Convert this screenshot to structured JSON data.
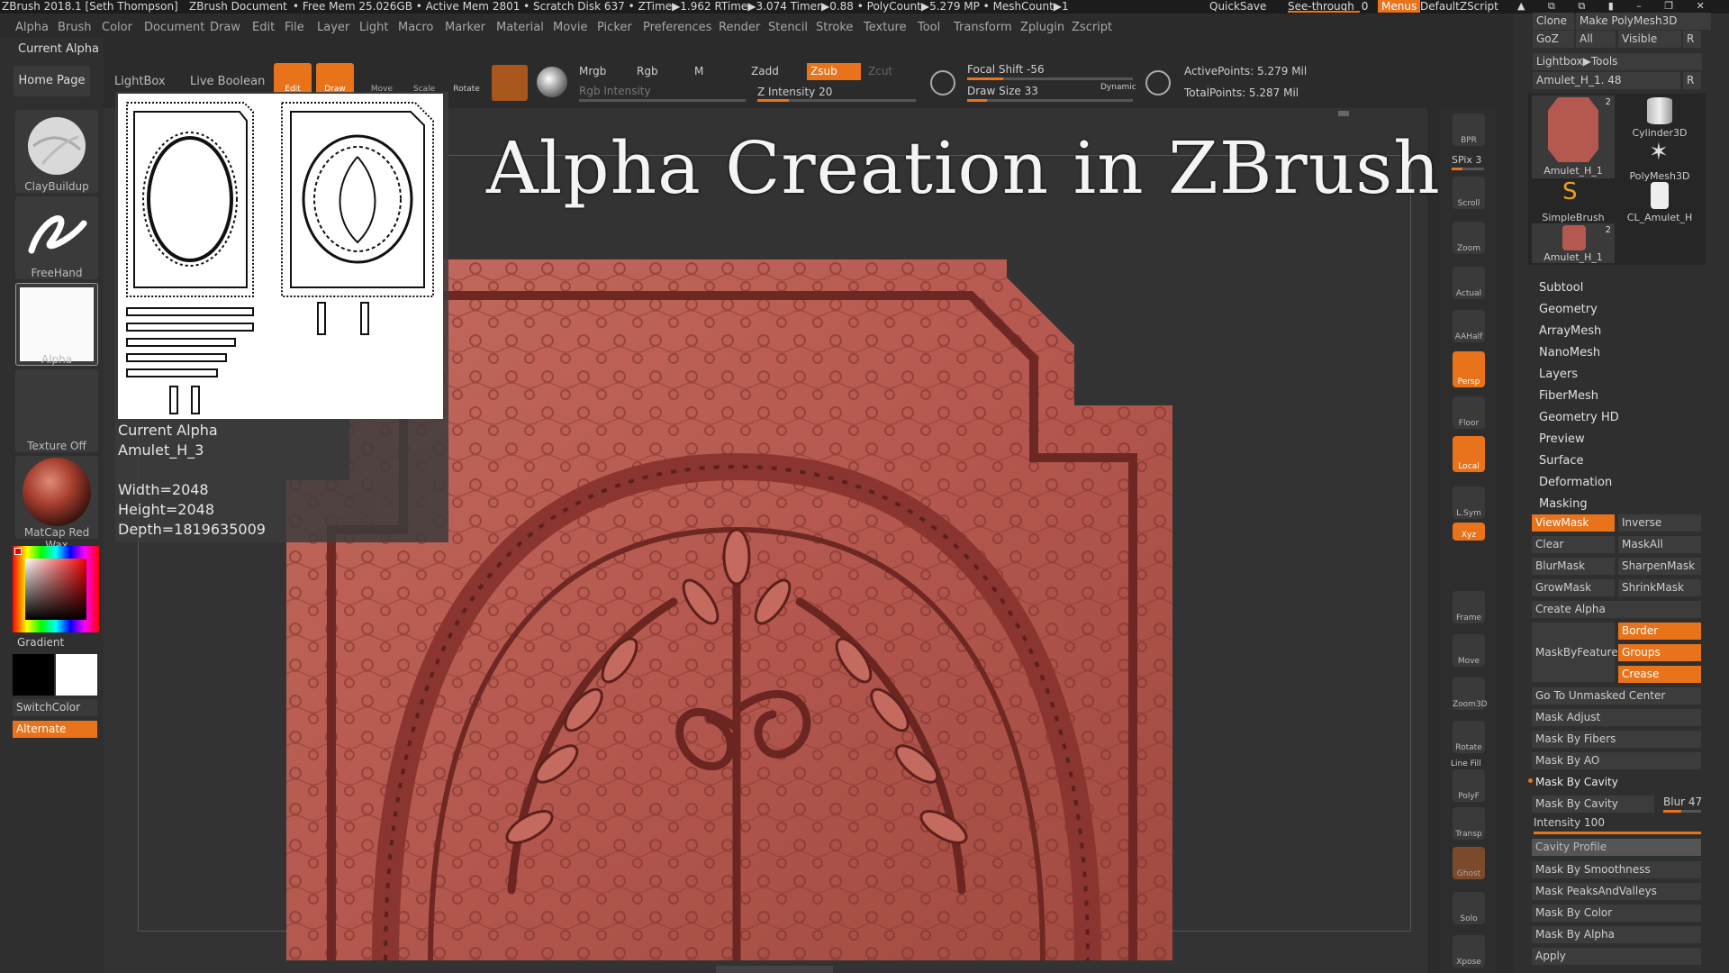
{
  "titlebar": {
    "app_title": "ZBrush 2018.1 [Seth Thompson]",
    "document": "ZBrush Document",
    "stats": "• Free Mem 25.026GB • Active Mem 2801 • Scratch Disk 637 • ZTime▶1.962 RTime▶3.074 Timer▶0.88 • PolyCount▶5.279 MP • MeshCount▶1",
    "quicksave": "QuickSave",
    "seethrough": "See-through",
    "seethrough_value": "0",
    "menus": "Menus",
    "script": "DefaultZScript"
  },
  "menubar": [
    "Alpha",
    "Brush",
    "Color",
    "Document",
    "Draw",
    "Edit",
    "File",
    "Layer",
    "Light",
    "Macro",
    "Marker",
    "Material",
    "Movie",
    "Picker",
    "Preferences",
    "Render",
    "Stencil",
    "Stroke",
    "Texture",
    "Tool",
    "Transform",
    "Zplugin",
    "Zscript"
  ],
  "left_shelf": {
    "current_alpha": "Current Alpha",
    "home_page": "Home Page",
    "lightbox": "LightBox",
    "live_boolean": "Live Boolean",
    "brush1": "ClayBuildup",
    "brush2": "FreeHand",
    "alpha": "Alpha",
    "texture": "Texture Off",
    "material": "MatCap Red Wax",
    "gradient": "Gradient",
    "switchcolor": "SwitchColor",
    "alternate": "Alternate"
  },
  "toolbar": {
    "edit": "Edit",
    "draw": "Draw",
    "move": "Move",
    "scale": "Scale",
    "rotate": "Rotate",
    "mrgb": "Mrgb",
    "rgb": "Rgb",
    "m": "M",
    "rgb_intensity": "Rgb Intensity",
    "zadd": "Zadd",
    "zsub": "Zsub",
    "zcut": "Zcut",
    "z_intensity": "Z Intensity 20",
    "focal_shift": "Focal Shift -56",
    "draw_size": "Draw Size 33",
    "dynamic": "Dynamic",
    "active_points": "ActivePoints: 5.279 Mil",
    "total_points": "TotalPoints: 5.287 Mil",
    "z_intensity_level": 0.2,
    "focal_shift_level": 0.22,
    "draw_size_level": 0.12
  },
  "canvas": {
    "title": "Alpha Creation in ZBrush"
  },
  "alpha_popup": {
    "label": "Current Alpha",
    "name": "Amulet_H_3",
    "width": "Width=2048",
    "height": "Height=2048",
    "depth": "Depth=1819635009"
  },
  "right_bar": {
    "bpr": "BPR",
    "spix": "SPix 3",
    "scroll": "Scroll",
    "zoom": "Zoom",
    "actual": "Actual",
    "aahalf": "AAHalf",
    "persp": "Persp",
    "floor": "Floor",
    "local": "Local",
    "lsym": "L.Sym",
    "xyz": "Xyz",
    "frame": "Frame",
    "move": "Move",
    "zoom3d": "Zoom3D",
    "rotate": "Rotate",
    "linefill": "Line Fill",
    "polyf": "PolyF",
    "transp": "Transp",
    "ghost": "Ghost",
    "solo": "Solo",
    "xpose": "Xpose"
  },
  "right_panel": {
    "clone": "Clone",
    "make_polymesh": "Make PolyMesh3D",
    "goz": "GoZ",
    "all": "All",
    "visible": "Visible",
    "r": "R",
    "lightbox_tools": "Lightbox▶Tools",
    "current_tool": "Amulet_H_1. 48",
    "tools": [
      {
        "name": "Amulet_H_1",
        "badge": "2"
      },
      {
        "name": "Cylinder3D",
        "badge": ""
      },
      {
        "name": "PolyMesh3D",
        "badge": ""
      },
      {
        "name": "SimpleBrush",
        "badge": ""
      },
      {
        "name": "CL_Amulet_H",
        "badge": ""
      },
      {
        "name": "Amulet_H_1",
        "badge": "2"
      }
    ],
    "subpalettes": [
      "Subtool",
      "Geometry",
      "ArrayMesh",
      "NanoMesh",
      "Layers",
      "FiberMesh",
      "Geometry HD",
      "Preview",
      "Surface",
      "Deformation",
      "Masking"
    ],
    "masking": {
      "viewmask": "ViewMask",
      "inverse": "Inverse",
      "clear": "Clear",
      "maskall": "MaskAll",
      "blurmask": "BlurMask",
      "sharpenmask": "SharpenMask",
      "growmask": "GrowMask",
      "shrinkmask": "ShrinkMask",
      "create_alpha": "Create Alpha",
      "maskbyfeature": "MaskByFeature",
      "border": "Border",
      "groups": "Groups",
      "crease": "Crease",
      "go_unmasked": "Go To Unmasked Center",
      "mask_adjust": "Mask Adjust",
      "mask_fibers": "Mask By Fibers",
      "mask_ao": "Mask By AO",
      "mask_cavity_header": "Mask By Cavity",
      "mask_cavity_btn": "Mask By Cavity",
      "blur": "Blur 47",
      "intensity": "Intensity 100",
      "cavity_profile": "Cavity Profile",
      "mask_smoothness": "Mask By Smoothness",
      "mask_peaks": "Mask PeaksAndValleys",
      "mask_color": "Mask By Color",
      "mask_alpha": "Mask By Alpha",
      "apply": "Apply",
      "blur_level": 0.47,
      "intensity_level": 1.0
    }
  },
  "colors": {
    "accent": "#e8731a",
    "model": "#b5584f",
    "model_dark": "#7a2f2a"
  }
}
